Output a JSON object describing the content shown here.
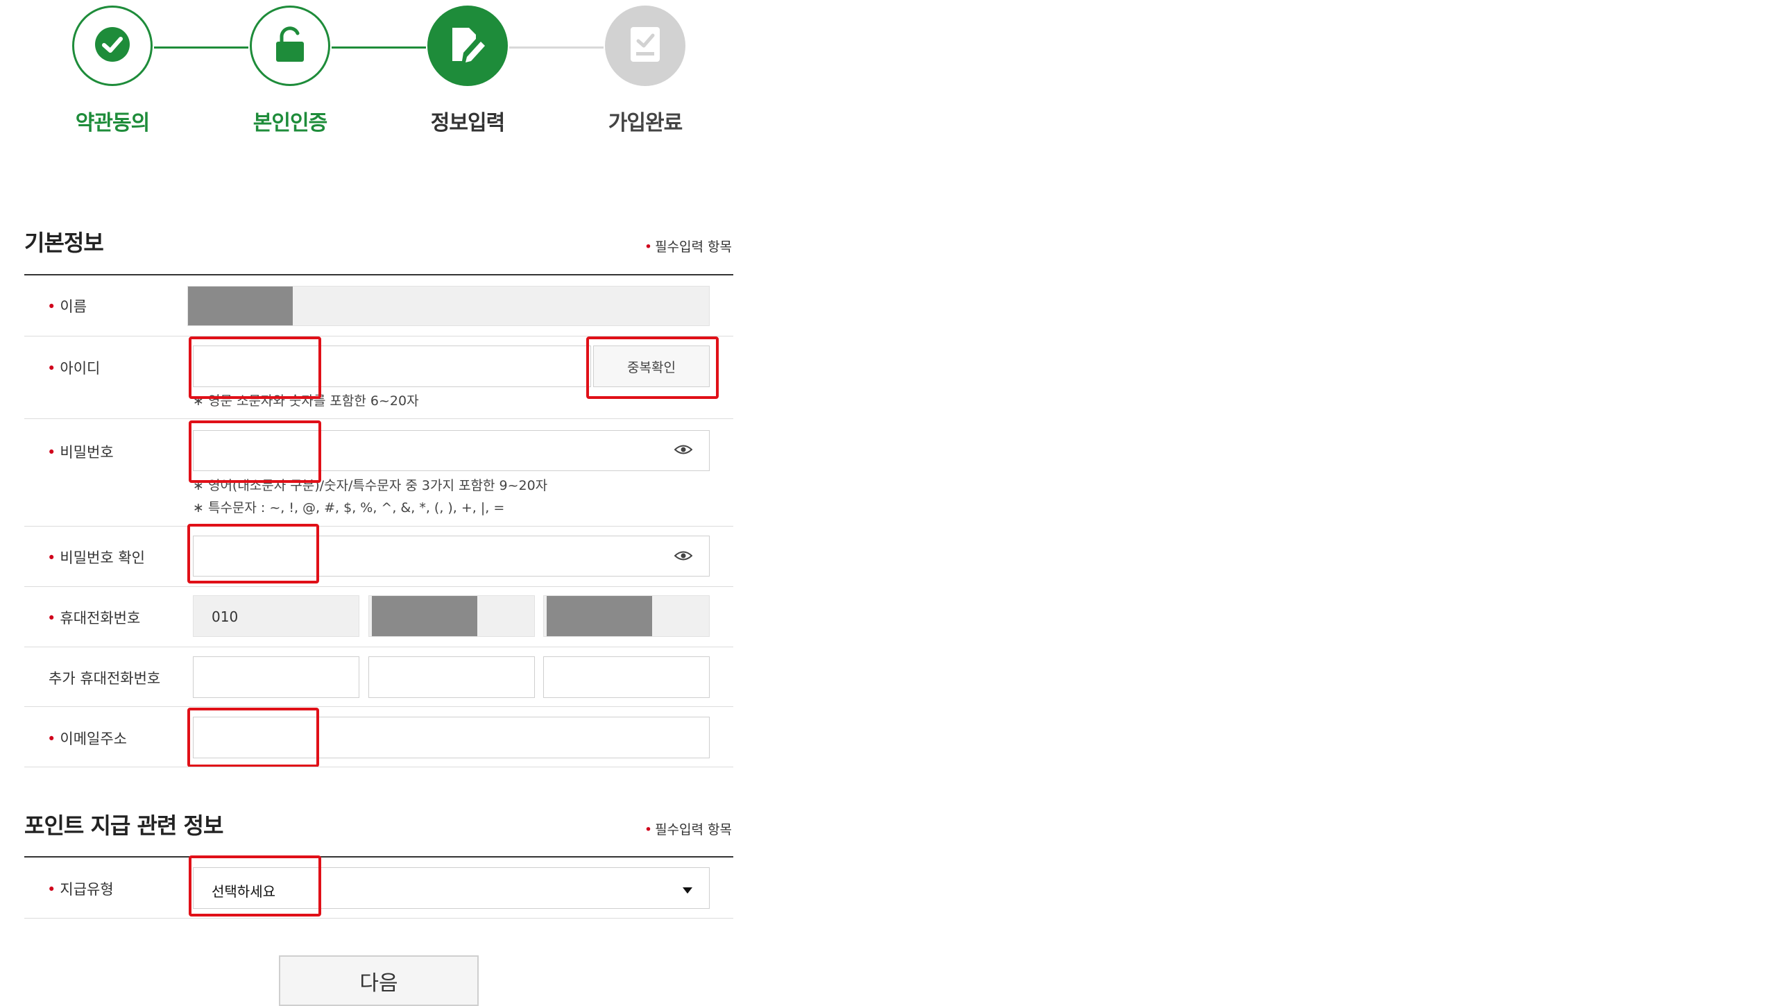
{
  "steps": [
    {
      "label": "약관동의",
      "state": "done",
      "icon": "check-icon"
    },
    {
      "label": "본인인증",
      "state": "done",
      "icon": "lock-icon"
    },
    {
      "label": "정보입력",
      "state": "current",
      "icon": "pencil-doc-icon"
    },
    {
      "label": "가입완료",
      "state": "pending",
      "icon": "doc-check-icon"
    }
  ],
  "colors": {
    "green": "#1e8c3a",
    "gray_step": "#d2d2d2",
    "required_dot": "#d0021b",
    "highlight": "#e01018"
  },
  "basic": {
    "title": "기본정보",
    "required_note": "필수입력 항목",
    "required_mark": "•",
    "name_label": "이름",
    "id_label": "아이디",
    "id_check_button": "중복확인",
    "id_hint": "∗ 영문 소문자와 숫자를 포함한 6~20자",
    "password_label": "비밀번호",
    "password_hint1": "∗ 영어(대소문자 구분)/숫자/특수문자 중 3가지 포함한 9~20자",
    "password_hint2": "∗ 특수문자 : ~, !, @, #, $, %, ^, &, *, (, ), +, |, =",
    "password_confirm_label": "비밀번호 확인",
    "phone_label": "휴대전화번호",
    "phone_prefix": "010",
    "extra_phone_label": "추가 휴대전화번호",
    "email_label": "이메일주소"
  },
  "point": {
    "title": "포인트 지급 관련 정보",
    "required_note": "필수입력 항목",
    "type_label": "지급유형",
    "type_selected": "선택하세요"
  },
  "next_button": "다음"
}
